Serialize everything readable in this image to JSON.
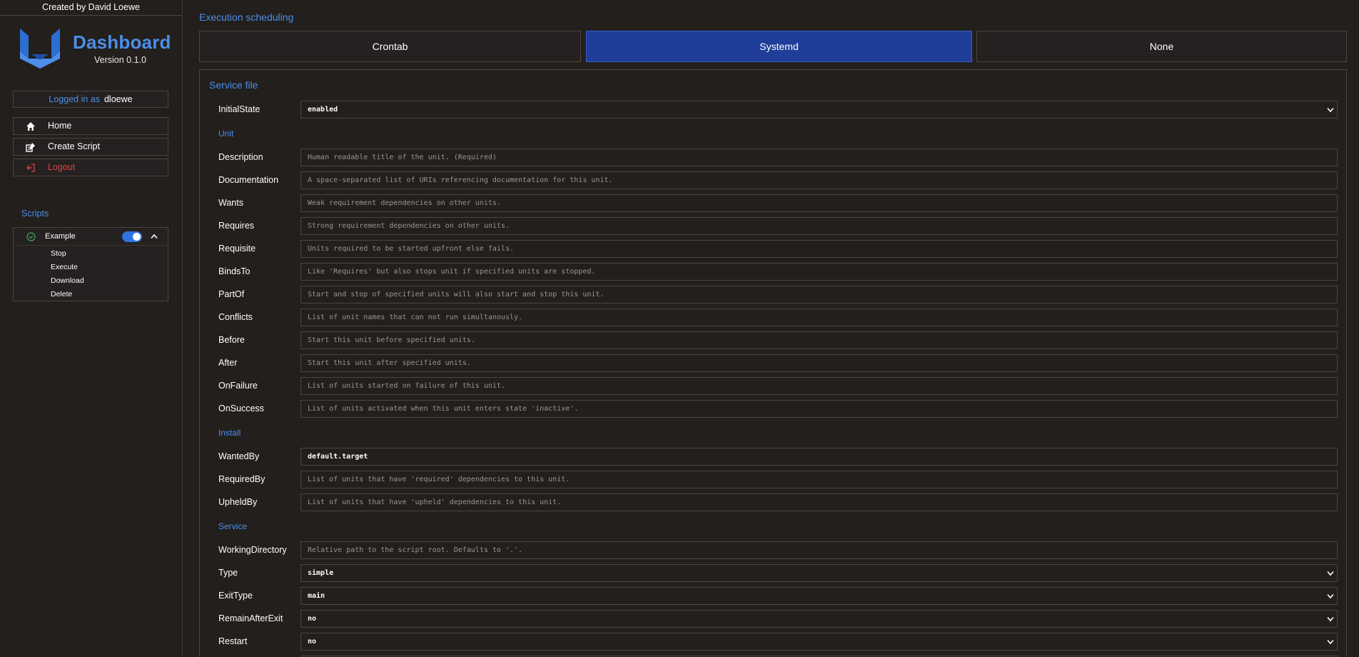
{
  "sidebar": {
    "credit": "Created by David Loewe",
    "brand_title": "Dashboard",
    "brand_version": "Version 0.1.0",
    "login_label": "Logged in as",
    "login_user": "dloewe",
    "nav": {
      "home": "Home",
      "create_script": "Create Script",
      "logout": "Logout"
    },
    "scripts_title": "Scripts",
    "script": {
      "name": "Example",
      "enabled": true,
      "actions": [
        "Stop",
        "Execute",
        "Download",
        "Delete"
      ]
    }
  },
  "main": {
    "exec_title": "Execution scheduling",
    "schedule_options": {
      "crontab": "Crontab",
      "systemd": "Systemd",
      "none": "None",
      "selected": "Systemd"
    },
    "service_title": "Service file",
    "initial_state": {
      "label": "InitialState",
      "value": "enabled"
    },
    "sections": {
      "unit": "Unit",
      "install": "Install",
      "service": "Service"
    },
    "unit_fields": [
      {
        "label": "Description",
        "placeholder": "Human readable title of the unit. (Required)"
      },
      {
        "label": "Documentation",
        "placeholder": "A space-separated list of URIs referencing documentation for this unit."
      },
      {
        "label": "Wants",
        "placeholder": "Weak requirement dependencies on other units."
      },
      {
        "label": "Requires",
        "placeholder": "Strong requirement dependencies on other units."
      },
      {
        "label": "Requisite",
        "placeholder": "Units required to be started upfront else fails."
      },
      {
        "label": "BindsTo",
        "placeholder": "Like 'Requires' but also stops unit if specified units are stopped."
      },
      {
        "label": "PartOf",
        "placeholder": "Start and stop of specified units will also start and stop this unit."
      },
      {
        "label": "Conflicts",
        "placeholder": "List of unit names that can not run simultanously."
      },
      {
        "label": "Before",
        "placeholder": "Start this unit before specified units."
      },
      {
        "label": "After",
        "placeholder": "Start this unit after specified units."
      },
      {
        "label": "OnFailure",
        "placeholder": "List of units started on failure of this unit."
      },
      {
        "label": "OnSuccess",
        "placeholder": "List of units activated when this unit enters state 'inactive'."
      }
    ],
    "install_fields": [
      {
        "label": "WantedBy",
        "value": "default.target"
      },
      {
        "label": "RequiredBy",
        "placeholder": "List of units that have 'required' dependencies to this unit."
      },
      {
        "label": "UpheldBy",
        "placeholder": "List of units that have 'upheld' dependencies to this unit."
      }
    ],
    "service_fields": [
      {
        "label": "WorkingDirectory",
        "placeholder": "Relative path to the script root. Defaults to '.'."
      },
      {
        "label": "Type",
        "value": "simple"
      },
      {
        "label": "ExitType",
        "value": "main"
      },
      {
        "label": "RemainAfterExit",
        "value": "no"
      },
      {
        "label": "Restart",
        "value": "no"
      }
    ]
  },
  "colors": {
    "background": "#221f1d",
    "accent": "#4d8ee8",
    "selected": "#1f3e99",
    "logout": "#e04545",
    "toggle_on": "#2f74e0",
    "border": "#4a4542"
  }
}
